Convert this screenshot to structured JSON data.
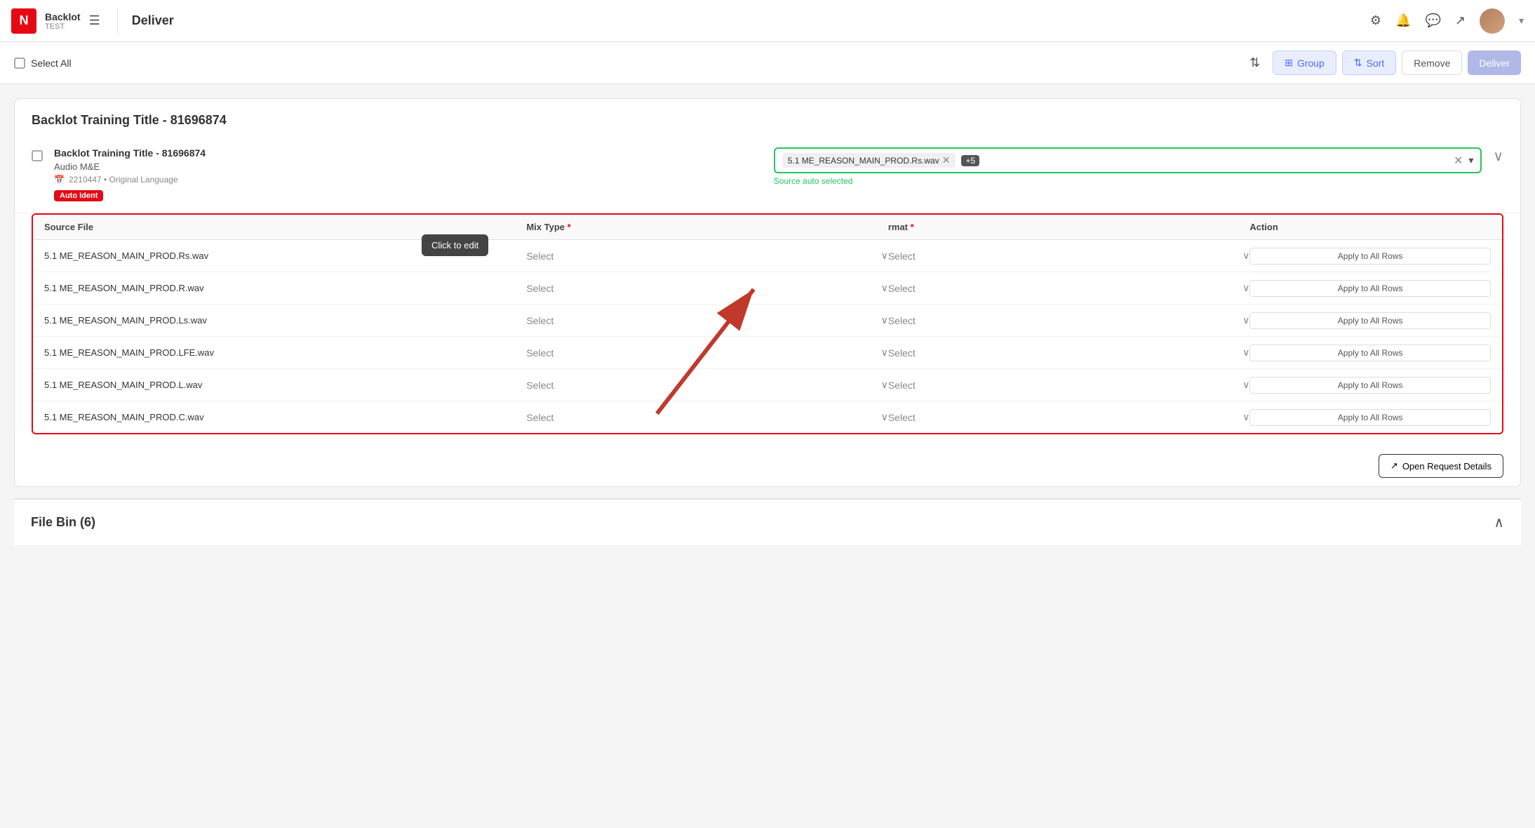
{
  "app": {
    "logo": "N",
    "name": "Backlot",
    "subtitle": "TEST",
    "page_title": "Deliver"
  },
  "toolbar": {
    "select_all_label": "Select All",
    "group_label": "Group",
    "sort_label": "Sort",
    "remove_label": "Remove",
    "deliver_label": "Deliver"
  },
  "section": {
    "title": "Backlot Training Title - 81696874",
    "item": {
      "name": "Backlot Training Title - 81696874",
      "track": "Audio M&E",
      "meta": "2210447 • Original Language",
      "badge": "Auto Ident",
      "source_tag": "5.1 ME_REASON_MAIN_PROD.Rs.wav",
      "source_count": "+5",
      "source_auto_label": "Source auto selected"
    }
  },
  "table": {
    "headers": {
      "source_file": "Source File",
      "mix_type": "Mix Type",
      "format": "rmat",
      "action": "Action"
    },
    "rows": [
      {
        "source": "5.1 ME_REASON_MAIN_PROD.Rs.wav",
        "mix_type": "Select",
        "format": "Select",
        "action": "Apply to All Rows"
      },
      {
        "source": "5.1 ME_REASON_MAIN_PROD.R.wav",
        "mix_type": "Select",
        "format": "Select",
        "action": "Apply to All Rows"
      },
      {
        "source": "5.1 ME_REASON_MAIN_PROD.Ls.wav",
        "mix_type": "Select",
        "format": "Select",
        "action": "Apply to All Rows"
      },
      {
        "source": "5.1 ME_REASON_MAIN_PROD.LFE.wav",
        "mix_type": "Select",
        "format": "Select",
        "action": "Apply to All Rows"
      },
      {
        "source": "5.1 ME_REASON_MAIN_PROD.L.wav",
        "mix_type": "Select",
        "format": "Select",
        "action": "Apply to All Rows"
      },
      {
        "source": "5.1 ME_REASON_MAIN_PROD.C.wav",
        "mix_type": "Select",
        "format": "Select",
        "action": "Apply to All Rows"
      }
    ],
    "tooltip": "Click to edit"
  },
  "open_request": {
    "label": "Open Request Details"
  },
  "file_bin": {
    "label": "File Bin (6)"
  }
}
